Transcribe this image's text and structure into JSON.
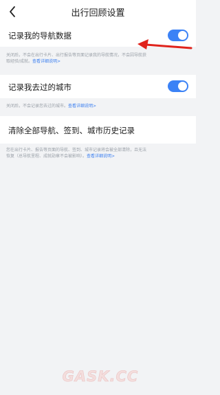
{
  "header": {
    "title": "出行回顾设置"
  },
  "settings": [
    {
      "label": "记录我的导航数据",
      "enabled": true,
      "desc_line1": "关闭后，不会在出行卡片、出行报告等页面记录我的导航情况，不会因导航获",
      "desc_line2": "取经验/成就。",
      "link": "查看详细说明>"
    },
    {
      "label": "记录我去过的城市",
      "enabled": true,
      "desc_line1": "关闭后，不会记录您去过的城市。",
      "link": "查看详细说明>"
    }
  ],
  "clear": {
    "label": "清除全部导航、签到、城市历史记录",
    "desc_line1": "您在出行卡片、报告等页面的导航、签到、城市记录将会被全部清除，且无法",
    "desc_line2": "恢复（总导航里程、成就勋章不会被影响）。",
    "link": "查看详细说明>"
  },
  "watermark": {
    "text": "GASK.CC"
  },
  "colors": {
    "accent": "#3b82f6",
    "link": "#3b7ff0",
    "arrow": "#e0231c"
  },
  "icons": {
    "back": "chevron-left-icon",
    "annotation": "red-arrow-icon"
  }
}
